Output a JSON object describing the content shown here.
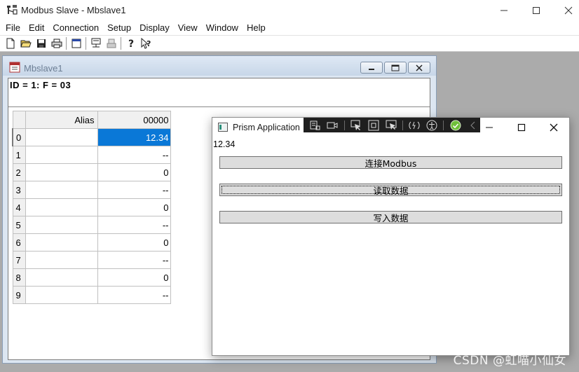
{
  "app": {
    "title": "Modbus Slave - Mbslave1",
    "menu": [
      "File",
      "Edit",
      "Connection",
      "Setup",
      "Display",
      "View",
      "Window",
      "Help"
    ],
    "toolbar_icons": [
      "new-document-icon",
      "open-folder-icon",
      "save-icon",
      "print-icon",
      "window-icon",
      "monitor-icon",
      "device-icon",
      "help-icon",
      "context-help-icon"
    ]
  },
  "child": {
    "title": "Mbslave1",
    "id_line": "ID = 1: F = 03",
    "grid": {
      "header": {
        "alias": "Alias",
        "address": "00000"
      },
      "rows": [
        {
          "index": "0",
          "alias": "",
          "value": "12.34"
        },
        {
          "index": "1",
          "alias": "",
          "value": "--"
        },
        {
          "index": "2",
          "alias": "",
          "value": "0"
        },
        {
          "index": "3",
          "alias": "",
          "value": "--"
        },
        {
          "index": "4",
          "alias": "",
          "value": "0"
        },
        {
          "index": "5",
          "alias": "",
          "value": "--"
        },
        {
          "index": "6",
          "alias": "",
          "value": "0"
        },
        {
          "index": "7",
          "alias": "",
          "value": "--"
        },
        {
          "index": "8",
          "alias": "",
          "value": "0"
        },
        {
          "index": "9",
          "alias": "",
          "value": "--"
        }
      ],
      "selected_color": "#0a78d7"
    }
  },
  "prism": {
    "title": "Prism Application",
    "value": "12.34",
    "buttons": [
      "连接Modbus",
      "读取数据",
      "写入数据"
    ],
    "focused_button": 1
  },
  "watermark": "CSDN @虹喵小仙女"
}
